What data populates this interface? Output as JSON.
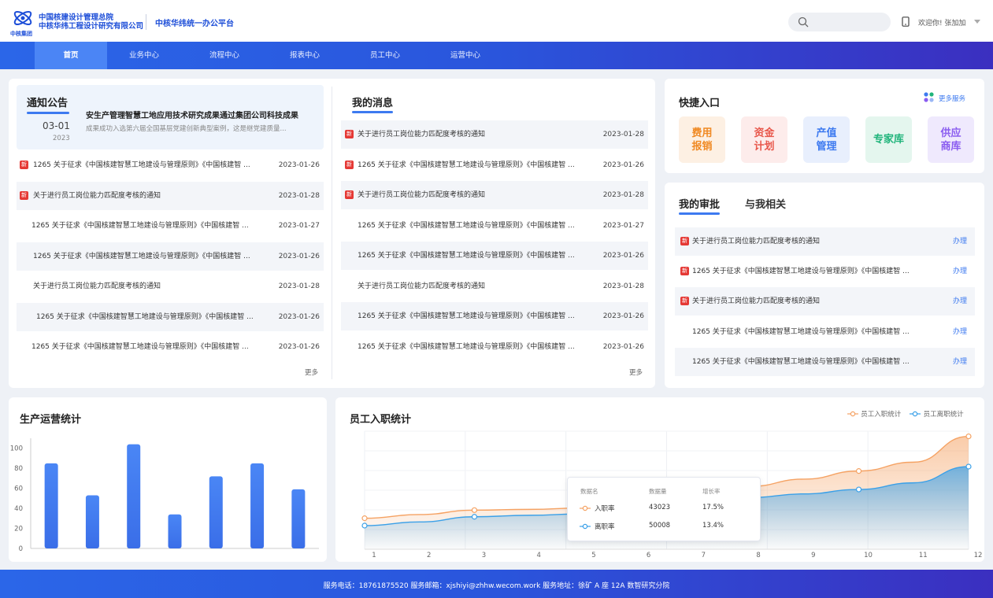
{
  "header": {
    "logo_line1": "中国核建设计管理总院",
    "logo_line2": "中核华纬工程设计研究有限公司",
    "logo_caption": "中核集团",
    "platform": "中核华纬统一办公平台",
    "welcome": "欢迎你! 张加加"
  },
  "nav": [
    "首页",
    "业务中心",
    "流程中心",
    "报表中心",
    "员工中心",
    "运营中心"
  ],
  "notice": {
    "title": "通知公告",
    "featured": {
      "date": "03-01",
      "year": "2023",
      "headline": "安生产管理智慧工地应用技术研究成果通过集团公司科技成果",
      "summary": "成果成功入选第六届全国基层党建创新典型案例，这是继党建质量..."
    },
    "rows": [
      {
        "text": "1265 关于征求《中国核建智慧工地建设与管理原则》《中国核建智 ...",
        "date": "2023-01-26",
        "new": true
      },
      {
        "text": "关于进行员工岗位能力匹配度考核的通知",
        "date": "2023-01-28",
        "new": true
      },
      {
        "text": "1265 关于征求《中国核建智慧工地建设与管理原则》《中国核建智 ...",
        "date": "2023-01-27",
        "new": false
      },
      {
        "text": "1265 关于征求《中国核建智慧工地建设与管理原则》《中国核建智 ...",
        "date": "2023-01-26",
        "new": false
      },
      {
        "text": "关于进行员工岗位能力匹配度考核的通知",
        "date": "2023-01-28",
        "new": false
      },
      {
        "text": "1265 关于征求《中国核建智慧工地建设与管理原则》《中国核建智 ...",
        "date": "2023-01-26",
        "new": false
      },
      {
        "text": "1265 关于征求《中国核建智慧工地建设与管理原则》《中国核建智 ...",
        "date": "2023-01-26",
        "new": false
      }
    ],
    "more": "更多"
  },
  "messages": {
    "title": "我的消息",
    "rows": [
      {
        "text": "关于进行员工岗位能力匹配度考核的通知",
        "date": "2023-01-28",
        "new": true
      },
      {
        "text": "1265 关于征求《中国核建智慧工地建设与管理原则》《中国核建智 ...",
        "date": "2023-01-26",
        "new": true
      },
      {
        "text": "关于进行员工岗位能力匹配度考核的通知",
        "date": "2023-01-28",
        "new": true
      },
      {
        "text": "1265 关于征求《中国核建智慧工地建设与管理原则》《中国核建智 ...",
        "date": "2023-01-27",
        "new": false
      },
      {
        "text": "1265 关于征求《中国核建智慧工地建设与管理原则》《中国核建智 ...",
        "date": "2023-01-26",
        "new": false
      },
      {
        "text": "关于进行员工岗位能力匹配度考核的通知",
        "date": "2023-01-28",
        "new": false
      },
      {
        "text": "1265 关于征求《中国核建智慧工地建设与管理原则》《中国核建智 ...",
        "date": "2023-01-26",
        "new": false
      },
      {
        "text": "1265 关于征求《中国核建智慧工地建设与管理原则》《中国核建智 ...",
        "date": "2023-01-26",
        "new": false
      }
    ],
    "more": "更多"
  },
  "quick": {
    "title": "快捷入口",
    "more_services": "更多服务",
    "tiles": [
      {
        "label1": "费用",
        "label2": "报销",
        "color": "#f08a24",
        "bg": "#fdf0e3"
      },
      {
        "label1": "资金",
        "label2": "计划",
        "color": "#e8564a",
        "bg": "#fdeceb"
      },
      {
        "label1": "产值",
        "label2": "管理",
        "color": "#3d7af0",
        "bg": "#e8effd"
      },
      {
        "label1": "专家库",
        "label2": "",
        "color": "#1fb47a",
        "bg": "#e4f6ee"
      },
      {
        "label1": "供应",
        "label2": "商库",
        "color": "#8a5cf0",
        "bg": "#efe9fd"
      }
    ]
  },
  "approval": {
    "tab1": "我的审批",
    "tab2": "与我相关",
    "action": "办理",
    "rows": [
      {
        "text": "关于进行员工岗位能力匹配度考核的通知",
        "new": true
      },
      {
        "text": "1265 关于征求《中国核建智慧工地建设与管理原则》《中国核建智 ...",
        "new": true
      },
      {
        "text": "关于进行员工岗位能力匹配度考核的通知",
        "new": true
      },
      {
        "text": "1265 关于征求《中国核建智慧工地建设与管理原则》《中国核建智 ...",
        "new": false
      },
      {
        "text": "1265 关于征求《中国核建智慧工地建设与管理原则》《中国核建智 ...",
        "new": false
      }
    ]
  },
  "production": {
    "title": "生产运营统计",
    "chart_data": {
      "type": "bar",
      "values": [
        85,
        53,
        104,
        34,
        72,
        85,
        59
      ],
      "ylim": [
        0,
        110
      ],
      "yticks": [
        0,
        20,
        40,
        60,
        80,
        100
      ]
    }
  },
  "employee": {
    "title": "员工入职统计",
    "legend": [
      "员工入职统计",
      "员工离职统计"
    ],
    "chart_data": {
      "type": "area",
      "x": [
        "1",
        "2",
        "3",
        "4",
        "5",
        "6",
        "7",
        "8",
        "9",
        "10",
        "11",
        "12"
      ],
      "series": [
        {
          "name": "员工入职统计",
          "color": "#f5a263",
          "values": [
            42,
            47,
            53,
            54,
            56,
            60,
            65,
            85,
            95,
            106,
            118,
            153
          ]
        },
        {
          "name": "员工离职统计",
          "color": "#3aa0e8",
          "values": [
            32,
            37,
            44,
            46,
            48,
            52,
            58,
            70,
            75,
            81,
            90,
            112
          ]
        }
      ],
      "ylim": [
        0,
        160
      ]
    },
    "tooltip": {
      "headers": [
        "数据名",
        "数据量",
        "增长率"
      ],
      "rows": [
        {
          "name": "入职率",
          "value": "43023",
          "rate": "17.5%"
        },
        {
          "name": "离职率",
          "value": "50008",
          "rate": "13.4%"
        }
      ]
    }
  },
  "footer": "服务电话：18761875520  服务邮箱：xjshiyi@zhhw.wecom.work 服务地址：徐矿 A 座 12A 数智研究分院"
}
